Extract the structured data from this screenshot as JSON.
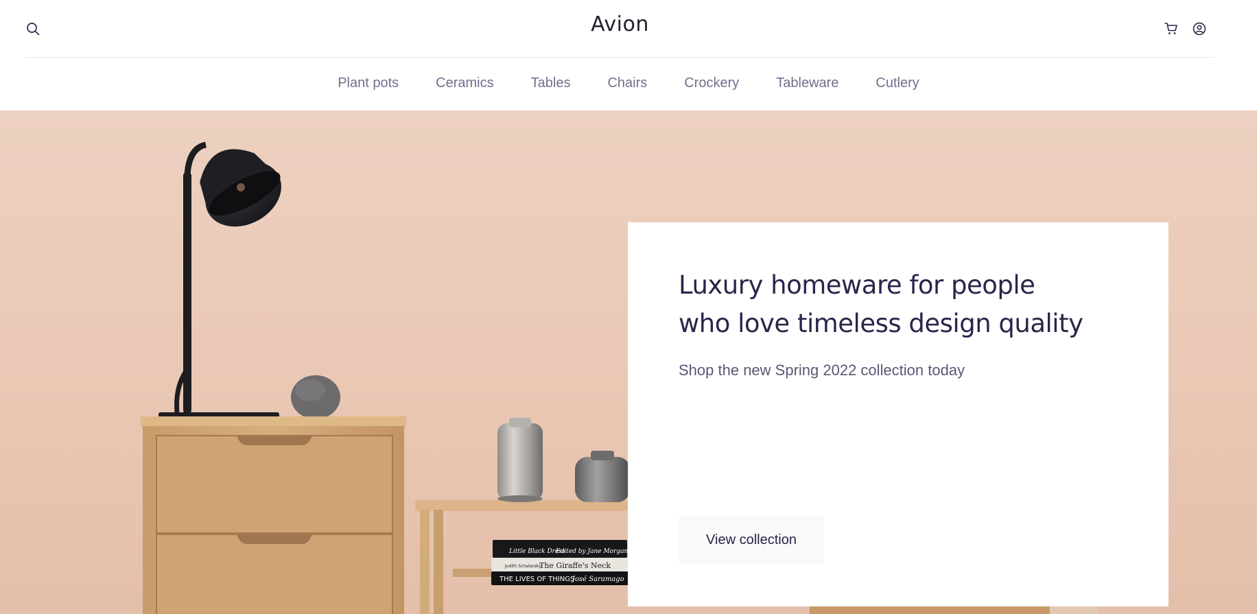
{
  "header": {
    "logo": "Avion",
    "search_icon": "search-icon",
    "cart_icon": "cart-icon",
    "account_icon": "user-circle-icon"
  },
  "nav": {
    "items": [
      {
        "label": "Plant pots"
      },
      {
        "label": "Ceramics"
      },
      {
        "label": "Tables"
      },
      {
        "label": "Chairs"
      },
      {
        "label": "Crockery"
      },
      {
        "label": "Tableware"
      },
      {
        "label": "Cutlery"
      }
    ]
  },
  "hero": {
    "title_line1": "Luxury homeware for people",
    "title_line2": "who love timeless design quality",
    "subtitle": "Shop the new Spring 2022 collection today",
    "cta_label": "View collection",
    "books": [
      {
        "author": "Little Black Dress",
        "publisher": "Edited by Jane Morgan"
      },
      {
        "author": "Judith Schalansky",
        "title": "The Giraffe's Neck"
      },
      {
        "title": "THE LIVES OF THINGS",
        "author": "José Saramago"
      }
    ]
  },
  "colors": {
    "brand_dark": "#2a254b",
    "nav_text": "#726e8d",
    "hero_bg": "#eed3c3",
    "cta_bg": "#f9f9f9"
  }
}
